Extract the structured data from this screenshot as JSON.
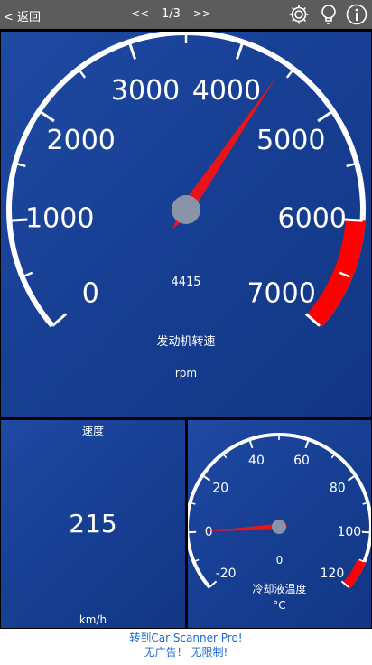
{
  "topbar": {
    "back_label": "< 返回",
    "prev_label": "<<",
    "page_indicator": "1/3",
    "next_label": ">>",
    "icons": [
      "gear-icon",
      "lightbulb-icon",
      "info-icon"
    ]
  },
  "rpm_gauge": {
    "scale_labels": [
      "0",
      "1000",
      "2000",
      "3000",
      "4000",
      "5000",
      "6000",
      "7000"
    ],
    "value": 4415,
    "value_text": "4415",
    "title": "发动机转速",
    "unit": "rpm",
    "min": 0,
    "max": 7000,
    "redline_from": 6000,
    "needle_color": "#e8141b",
    "redline_color": "#ff0000"
  },
  "speed_panel": {
    "title": "速度",
    "value": "215",
    "unit": "km/h"
  },
  "coolant_gauge": {
    "scale_labels": [
      "-20",
      "0",
      "20",
      "40",
      "60",
      "80",
      "100",
      "120"
    ],
    "value_text": "0",
    "value": 0,
    "title": "冷却液温度",
    "unit": "°C",
    "min": -20,
    "max": 120,
    "redline_from": 110
  },
  "promo": {
    "line1": "转到Car Scanner Pro!",
    "line2": "无广告！ 无限制!"
  },
  "colors": {
    "panel_blue": "#1a429a",
    "topbar_gray": "#5c5c5c",
    "promo_link": "#1a6bd1"
  }
}
